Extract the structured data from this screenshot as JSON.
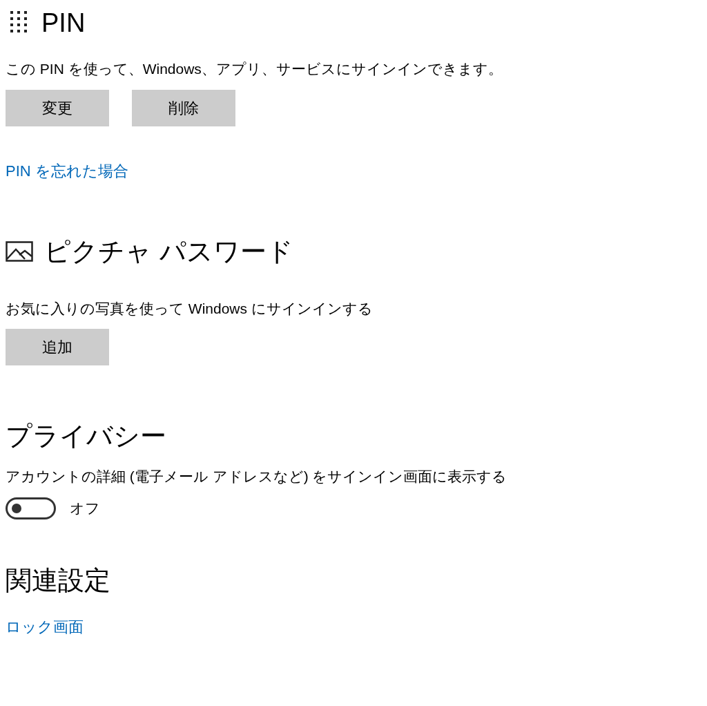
{
  "pin": {
    "title": "PIN",
    "description": "この PIN を使って、Windows、アプリ、サービスにサインインできます。",
    "buttons": [
      "変更",
      "削除"
    ],
    "link": "PIN を忘れた場合"
  },
  "picture_password": {
    "title": "ピクチャ パスワード",
    "description": "お気に入りの写真を使って Windows にサインインする",
    "buttons": [
      "追加"
    ]
  },
  "privacy": {
    "title": "プライバシー",
    "description": "アカウントの詳細 (電子メール アドレスなど) をサインイン画面に表示する",
    "toggle": {
      "on": false,
      "label": "オフ"
    }
  },
  "related": {
    "title": "関連設定",
    "link": "ロック画面"
  }
}
